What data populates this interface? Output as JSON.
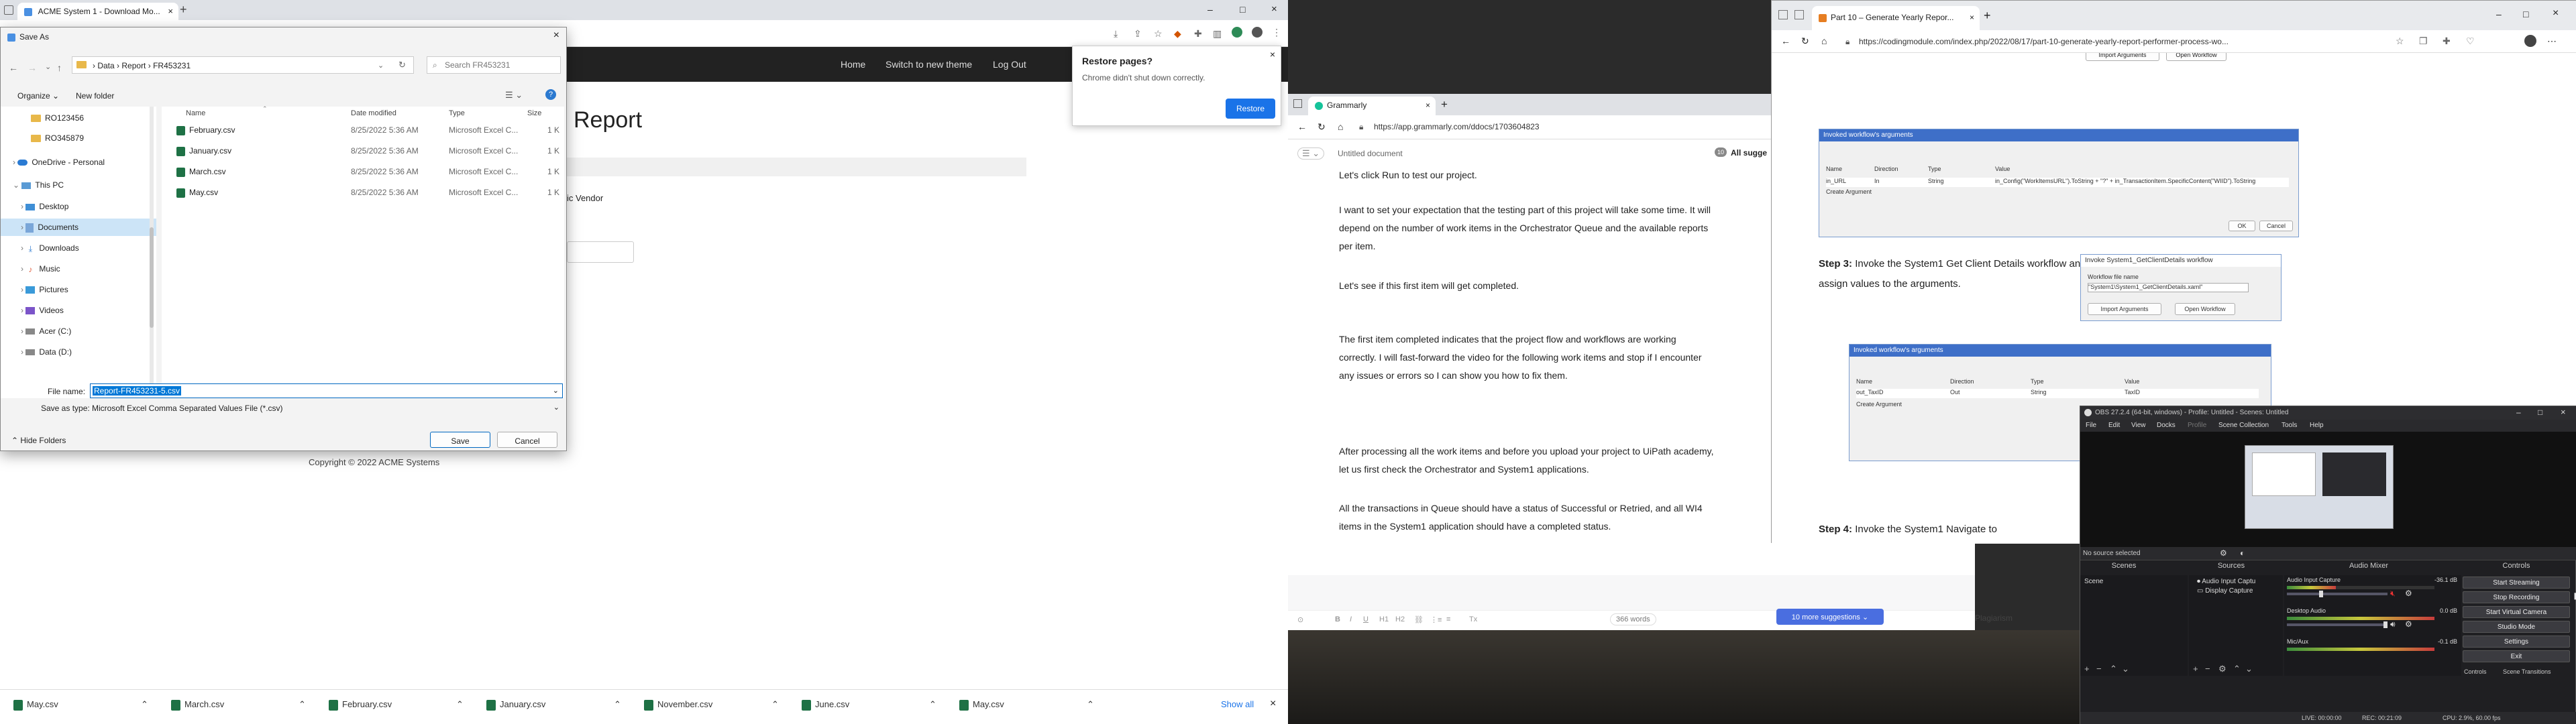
{
  "chrome": {
    "tab_title": "ACME System 1 - Download Mo...",
    "nav": [
      "Home",
      "Switch to new theme",
      "Log Out"
    ],
    "heading": "Report",
    "vendor_text": "ic Vendor",
    "copyright": "Copyright © 2022 ACME Systems",
    "restore": {
      "title": "Restore pages?",
      "message": "Chrome didn't shut down correctly.",
      "button": "Restore"
    },
    "downloads": [
      "May.csv",
      "March.csv",
      "February.csv",
      "January.csv",
      "November.csv",
      "June.csv",
      "May.csv"
    ],
    "show_all": "Show all"
  },
  "dialog": {
    "title": "Save As",
    "breadcrumb": [
      "Data",
      "Report",
      "FR453231"
    ],
    "search_placeholder": "Search FR453231",
    "organize": "Organize",
    "new_folder": "New folder",
    "columns": [
      "Name",
      "Date modified",
      "Type",
      "Size"
    ],
    "files": [
      {
        "name": "February.csv",
        "date": "8/25/2022 5:36 AM",
        "type": "Microsoft Excel C...",
        "size": "1 K"
      },
      {
        "name": "January.csv",
        "date": "8/25/2022 5:36 AM",
        "type": "Microsoft Excel C...",
        "size": "1 K"
      },
      {
        "name": "March.csv",
        "date": "8/25/2022 5:36 AM",
        "type": "Microsoft Excel C...",
        "size": "1 K"
      },
      {
        "name": "May.csv",
        "date": "8/25/2022 5:36 AM",
        "type": "Microsoft Excel C...",
        "size": "1 K"
      }
    ],
    "sidebar": [
      "RO123456",
      "RO345879",
      "OneDrive - Personal",
      "This PC",
      "Desktop",
      "Documents",
      "Downloads",
      "Music",
      "Pictures",
      "Videos",
      "Acer (C:)",
      "Data (D:)"
    ],
    "file_name_label": "File name:",
    "file_name_value": "Report-FR453231-5.csv",
    "save_type_label": "Save as type:",
    "save_type_value": "Microsoft Excel Comma Separated Values File (*.csv)",
    "hide_folders": "Hide Folders",
    "save": "Save",
    "cancel": "Cancel"
  },
  "grammarly": {
    "tab_title": "Grammarly",
    "url": "https://app.grammarly.com/ddocs/1703604823",
    "doc_title": "Untitled document",
    "all_suggestions": "All sugge",
    "suggestion_count": "10",
    "paragraphs": [
      "Let's click Run to test our project.",
      "I want to set your expectation that the testing part of this project will take some time. It will depend on the number of work items in the Orchestrator Queue and the available reports per item.",
      "Let's see if this first item will get completed.",
      "The first item completed indicates that the project flow and workflows are working correctly. I will fast-forward the video for the following work items and stop if I encounter any issues or errors so I can show you how to fix them.",
      "After processing all the work items and before you upload your project to UiPath academy, let us first check the Orchestrator and System1 applications.",
      "All the transactions in Queue should have a status of Successful or Retried, and all WI4 items in the System1 application should have a completed status."
    ],
    "more_suggestions": "10 more suggestions",
    "word_count": "366 words",
    "plagiarism": "Plagiarism"
  },
  "edge": {
    "tab_title": "Part 10 – Generate Yearly Repor...",
    "url": "https://codingmodule.com/index.php/2022/08/17/part-10-generate-yearly-report-performer-process-wo...",
    "step3": "Step 3:",
    "step3_text": "Invoke the System1 Get Client Details workflow and assign values to the arguments.",
    "step4": "Step 4:",
    "step4_text": "Invoke the System1 Navigate to",
    "wf1_title": "Invoked workflow's arguments",
    "wf1_headers": [
      "Name",
      "Direction",
      "Type",
      "Value"
    ],
    "wf1_row": [
      "in_URL",
      "In",
      "String",
      "in_Config(\"WorkItemsURL\").ToString + \"?\" + in_TransactionItem.SpecificContent(\"WIID\").ToString"
    ],
    "wf1_create": "Create Argument",
    "ok": "OK",
    "cancel": "Cancel",
    "invoke_title": "Invoke System1_GetClientDetails workflow",
    "invoke_label": "Workflow file name",
    "invoke_value": "\"System1\\System1_GetClientDetails.xaml\"",
    "import_args": "Import Arguments",
    "open_workflow": "Open Workflow",
    "wf2_title": "Invoked workflow's arguments",
    "wf2_row": [
      "out_TaxID",
      "Out",
      "String",
      "TaxID"
    ],
    "wf2_create": "Create Argument",
    "top_buttons": [
      "Import Arguments",
      "Open Workflow"
    ]
  },
  "obs": {
    "title": "OBS 27.2.4 (64-bit, windows) - Profile: Untitled - Scenes: Untitled",
    "menu": [
      "File",
      "Edit",
      "View",
      "Docks",
      "Profile",
      "Scene Collection",
      "Tools",
      "Help"
    ],
    "no_source": "No source selected",
    "panels": [
      "Scenes",
      "Sources",
      "Audio Mixer",
      "Controls"
    ],
    "scene": "Scene",
    "sources": [
      "Audio Input Captu",
      "Display Capture"
    ],
    "mixer": [
      {
        "name": "Audio Input Capture",
        "db": "-36.1 dB",
        "level": 0.33
      },
      {
        "name": "Desktop Audio",
        "db": "0.0 dB",
        "level": 1.0
      },
      {
        "name": "Mic/Aux",
        "db": "-0.1 dB",
        "level": 1.0
      }
    ],
    "controls": [
      "Start Streaming",
      "Stop Recording",
      "Start Virtual Camera",
      "Studio Mode",
      "Settings",
      "Exit"
    ],
    "control_tabs": [
      "Controls",
      "Scene Transitions"
    ],
    "status": {
      "live": "LIVE: 00:00:00",
      "rec": "REC: 00:21:09",
      "cpu": "CPU: 2.9%, 60.00 fps"
    }
  }
}
